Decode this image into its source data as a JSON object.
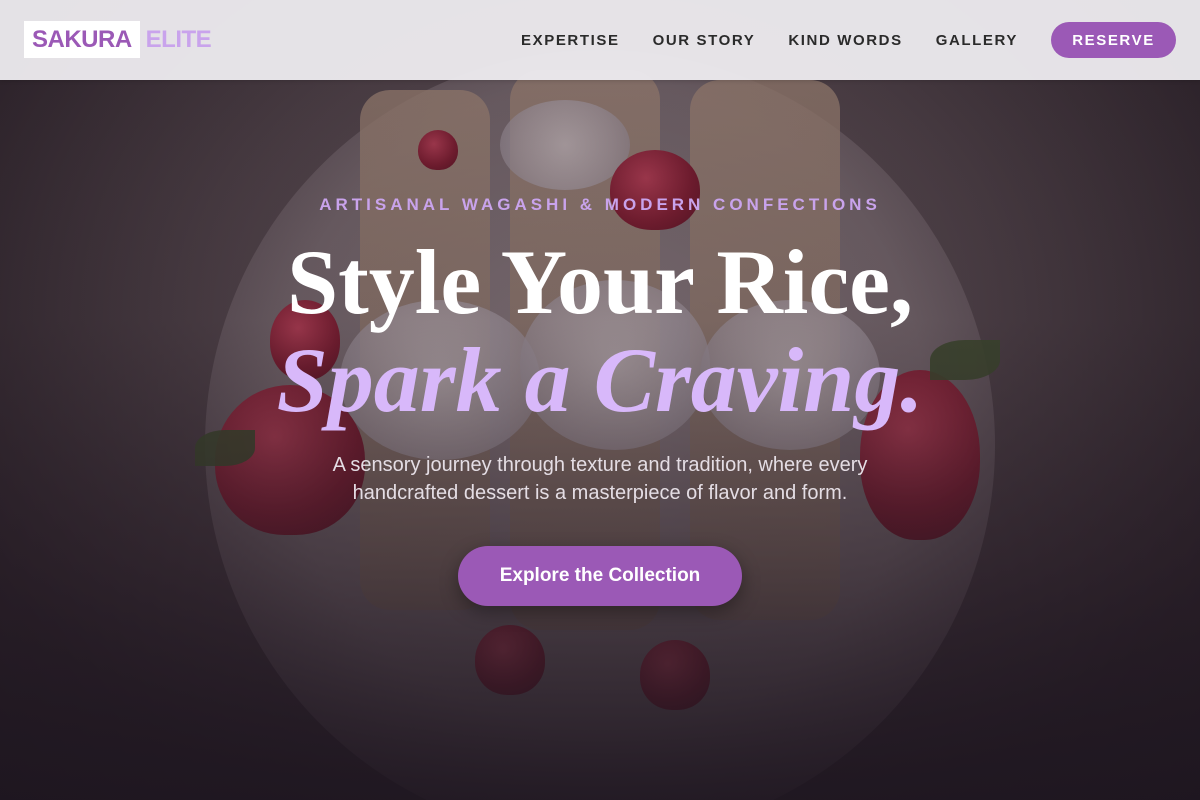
{
  "brand": {
    "part1": "SAKURA",
    "part2": "ELITE"
  },
  "nav": {
    "links": [
      "EXPERTISE",
      "OUR STORY",
      "KIND WORDS",
      "GALLERY"
    ],
    "reserve_label": "RESERVE"
  },
  "hero": {
    "eyebrow": "ARTISANAL WAGASHI & MODERN CONFECTIONS",
    "title_line1": "Style Your Rice,",
    "title_line2": "Spark a Craving.",
    "subtitle": "A sensory journey through texture and tradition, where every handcrafted dessert is a masterpiece of flavor and form.",
    "cta_label": "Explore the Collection"
  },
  "colors": {
    "accent": "#9b59b6",
    "accent_light": "#c9a3ec",
    "headline_italic": "#d8b8fa"
  }
}
